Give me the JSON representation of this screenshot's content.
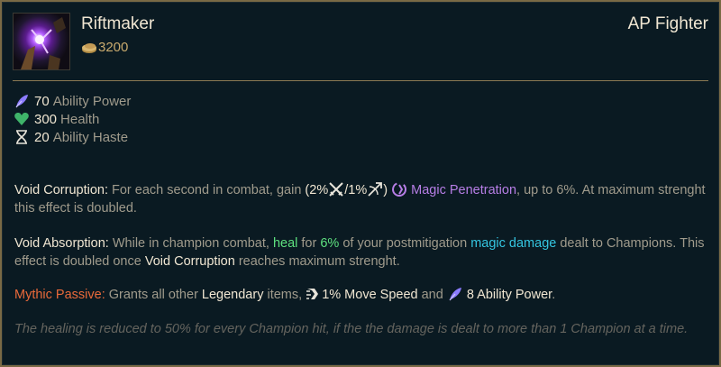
{
  "item": {
    "name": "Riftmaker",
    "cost": "3200",
    "tag": "AP Fighter"
  },
  "stats": [
    {
      "icon": "ability-power-icon",
      "value": "70",
      "label": "Ability Power"
    },
    {
      "icon": "health-icon",
      "value": "300",
      "label": "Health"
    },
    {
      "icon": "ability-haste-icon",
      "value": "20",
      "label": "Ability Haste"
    }
  ],
  "void_corruption": {
    "name": "Void Corruption:",
    "text1": " For each second in combat, gain ",
    "paren_open": "(",
    "val_melee": "2%",
    "slash": "/",
    "val_ranged": "1%",
    "paren_close": ")",
    "magic_pen": "Magic Penetration",
    "text2": ", up to 6%. At maximum strenght this effect is doubled."
  },
  "void_absorption": {
    "name": "Void Absorption:",
    "text1": " While in champion combat, ",
    "heal": "heal",
    "text2": " for ",
    "percent": "6%",
    "text3": " of your postmitigation ",
    "magic_damage": "magic damage",
    "text4": " dealt to Champions. This effect is doubled once ",
    "void_corruption": "Void Corruption",
    "text5": " reaches maximum strenght."
  },
  "mythic_passive": {
    "name": "Mythic Passive:",
    "text1": " Grants all other ",
    "legendary": "Legendary",
    "text2": " items, ",
    "move_speed": "1% Move Speed",
    "text3": " and ",
    "ability_power": "8 Ability Power",
    "text4": "."
  },
  "note": "The healing is reduced to 50% for every Champion hit, if the the damage is dealt to more than 1 Champion at a time.",
  "colors": {
    "background": "#0a1a22",
    "border_gold": "#7a6a45",
    "gold_text": "#c8aa6e",
    "magic_purple": "#b77ee6",
    "heal_green": "#5ee07f",
    "magic_cyan": "#34c5e0",
    "mythic_orange": "#e8693a"
  }
}
